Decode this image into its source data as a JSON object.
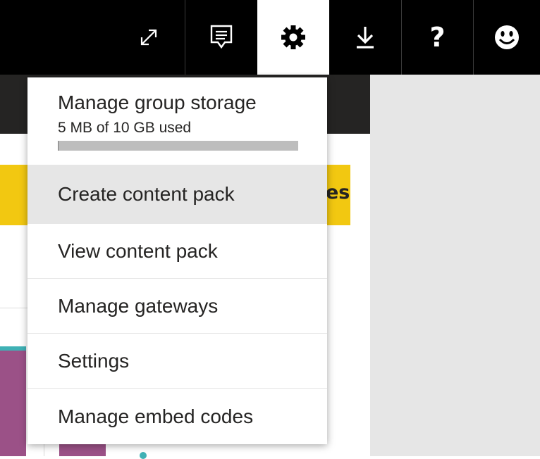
{
  "topbar": {
    "buttons": [
      {
        "name": "fullscreen-button",
        "icon": "expand-icon"
      },
      {
        "name": "feedback-button",
        "icon": "comment-icon"
      },
      {
        "name": "settings-button",
        "icon": "gear-icon",
        "active": true
      },
      {
        "name": "download-button",
        "icon": "download-icon"
      },
      {
        "name": "help-button",
        "icon": "question-mark-icon",
        "glyph": "?"
      },
      {
        "name": "smiley-button",
        "icon": "smiley-icon"
      }
    ]
  },
  "background": {
    "banner_tail": "es"
  },
  "settings_menu": {
    "storage": {
      "title": "Manage group storage",
      "used": "5 MB of 10 GB used",
      "used_fraction": 0.0005
    },
    "items": [
      {
        "label": "Create content pack",
        "highlighted": true
      },
      {
        "label": "View content pack"
      },
      {
        "label": "Manage gateways"
      },
      {
        "label": "Settings"
      },
      {
        "label": "Manage embed codes"
      }
    ]
  },
  "colors": {
    "topbar": "#000000",
    "banner": "#f2c811",
    "menu_hover": "#e6e6e6",
    "text": "#252423",
    "chart_purple": "#9b5187",
    "chart_teal": "#3fb1b5"
  }
}
